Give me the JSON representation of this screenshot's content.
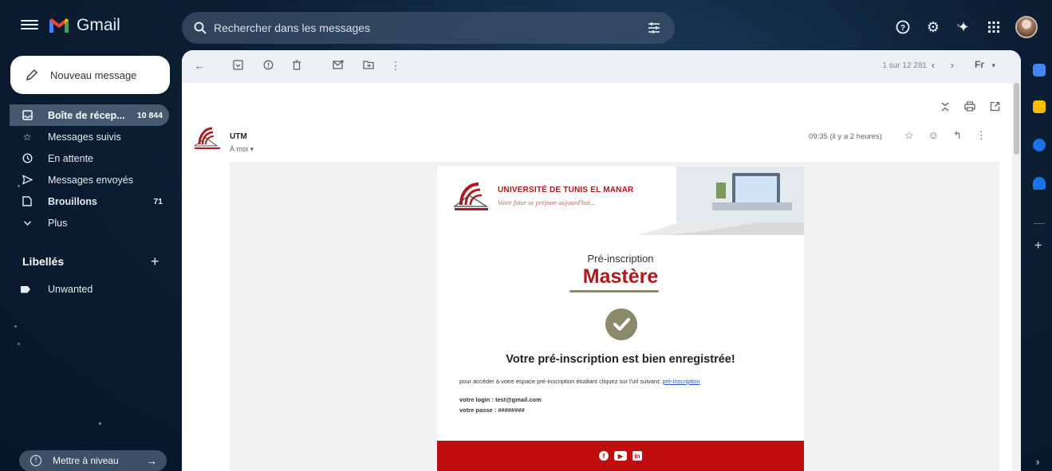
{
  "app": {
    "name": "Gmail"
  },
  "search": {
    "placeholder": "Rechercher dans les messages"
  },
  "compose": {
    "label": "Nouveau message"
  },
  "nav": {
    "items": [
      {
        "label": "Boîte de récep...",
        "count": "10 844",
        "icon": "inbox-icon"
      },
      {
        "label": "Messages suivis",
        "count": "",
        "icon": "star-icon"
      },
      {
        "label": "En attente",
        "count": "",
        "icon": "clock-icon"
      },
      {
        "label": "Messages envoyés",
        "count": "",
        "icon": "send-icon"
      },
      {
        "label": "Brouillons",
        "count": "71",
        "icon": "draft-icon"
      },
      {
        "label": "Plus",
        "count": "",
        "icon": "chevron-down-icon"
      }
    ]
  },
  "labels": {
    "heading": "Libellés",
    "items": [
      "Unwanted"
    ]
  },
  "upgrade": {
    "label": "Mettre à niveau"
  },
  "toolbar": {
    "pager": "1 sur 12 281",
    "input_tools": "Fr"
  },
  "message": {
    "sender": "UTM",
    "recipient": "À moi",
    "time": "09:35 (il y a 2 heures)"
  },
  "email": {
    "university": "UNIVERSITÉ DE TUNIS EL MANAR",
    "slogan": "Votre futur se prépare aujourd'hui...",
    "pre_title": "Pré-inscription",
    "title": "Mastère",
    "confirmation": "Votre pré-inscription est bien enregistrée!",
    "access_text": "pour accéder à votre espace pré-inscription étudiant cliquez sur l'url suivant: ",
    "access_link": "pré-inscription",
    "login_line": "votre login : test@gmail.com",
    "password_line": "votre passe : ########"
  },
  "colors": {
    "brand_red": "#c00d0d",
    "accent_olive": "#8a8a6a",
    "link": "#2c5ab8"
  }
}
